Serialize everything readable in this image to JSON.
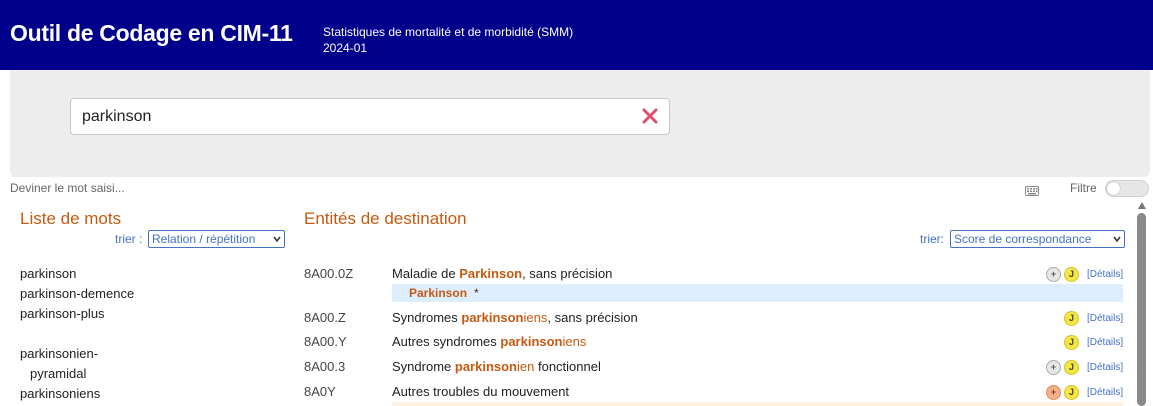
{
  "header": {
    "app_title": "Outil de Codage en CIM-11",
    "subtitle_line1": "Statistiques de mortalité et de morbidité (SMM)",
    "subtitle_line2": "2024-01",
    "bg_color": "#00008b"
  },
  "search": {
    "value": "parkinson",
    "clear_icon": "close-icon",
    "clear_color": "#e0506e"
  },
  "toolbar": {
    "guess_text": "Deviner le mot saisi...",
    "keyboard_icon": "keyboard-icon",
    "filter_label": "Filtre",
    "filter_on": false
  },
  "word_list": {
    "title": "Liste de mots",
    "sort_label": "trier :",
    "sort_value": "Relation / répétition",
    "items": [
      "parkinson",
      "parkinson-demence",
      "parkinson-plus",
      "parkinsonien-",
      "pyramidal",
      "parkinsoniens"
    ]
  },
  "entities": {
    "title": "Entités de destination",
    "sort_label": "trier:",
    "sort_value": "Score de correspondance",
    "details_label": "[Détails]",
    "rows": [
      {
        "code": "8A00.0Z",
        "pre": "Maladie de ",
        "hl": "Parkinson",
        "hl_tail": "",
        "post": ", sans précision",
        "badges": [
          "plus",
          "J"
        ]
      },
      {
        "code": "8A00.Z",
        "pre": "Syndromes ",
        "hl": "parkinson",
        "hl_tail": "iens",
        "post": ", sans précision",
        "badges": [
          "J"
        ]
      },
      {
        "code": "8A00.Y",
        "pre": "Autres syndromes ",
        "hl": "parkinson",
        "hl_tail": "iens",
        "post": "",
        "badges": [
          "J"
        ]
      },
      {
        "code": "8A00.3",
        "pre": "Syndrome ",
        "hl": "parkinson",
        "hl_tail": "ien",
        "post": " fonctionnel",
        "badges": [
          "plus",
          "J"
        ]
      },
      {
        "code": "8A0Y",
        "pre": "Autres troubles du mouvement",
        "hl": "",
        "hl_tail": "",
        "post": "",
        "badges": [
          "plus-orange",
          "J"
        ]
      }
    ],
    "sub_row": {
      "hl": "Parkinson",
      "mark": "*"
    },
    "badge_plus": "+",
    "badge_j": "J"
  }
}
